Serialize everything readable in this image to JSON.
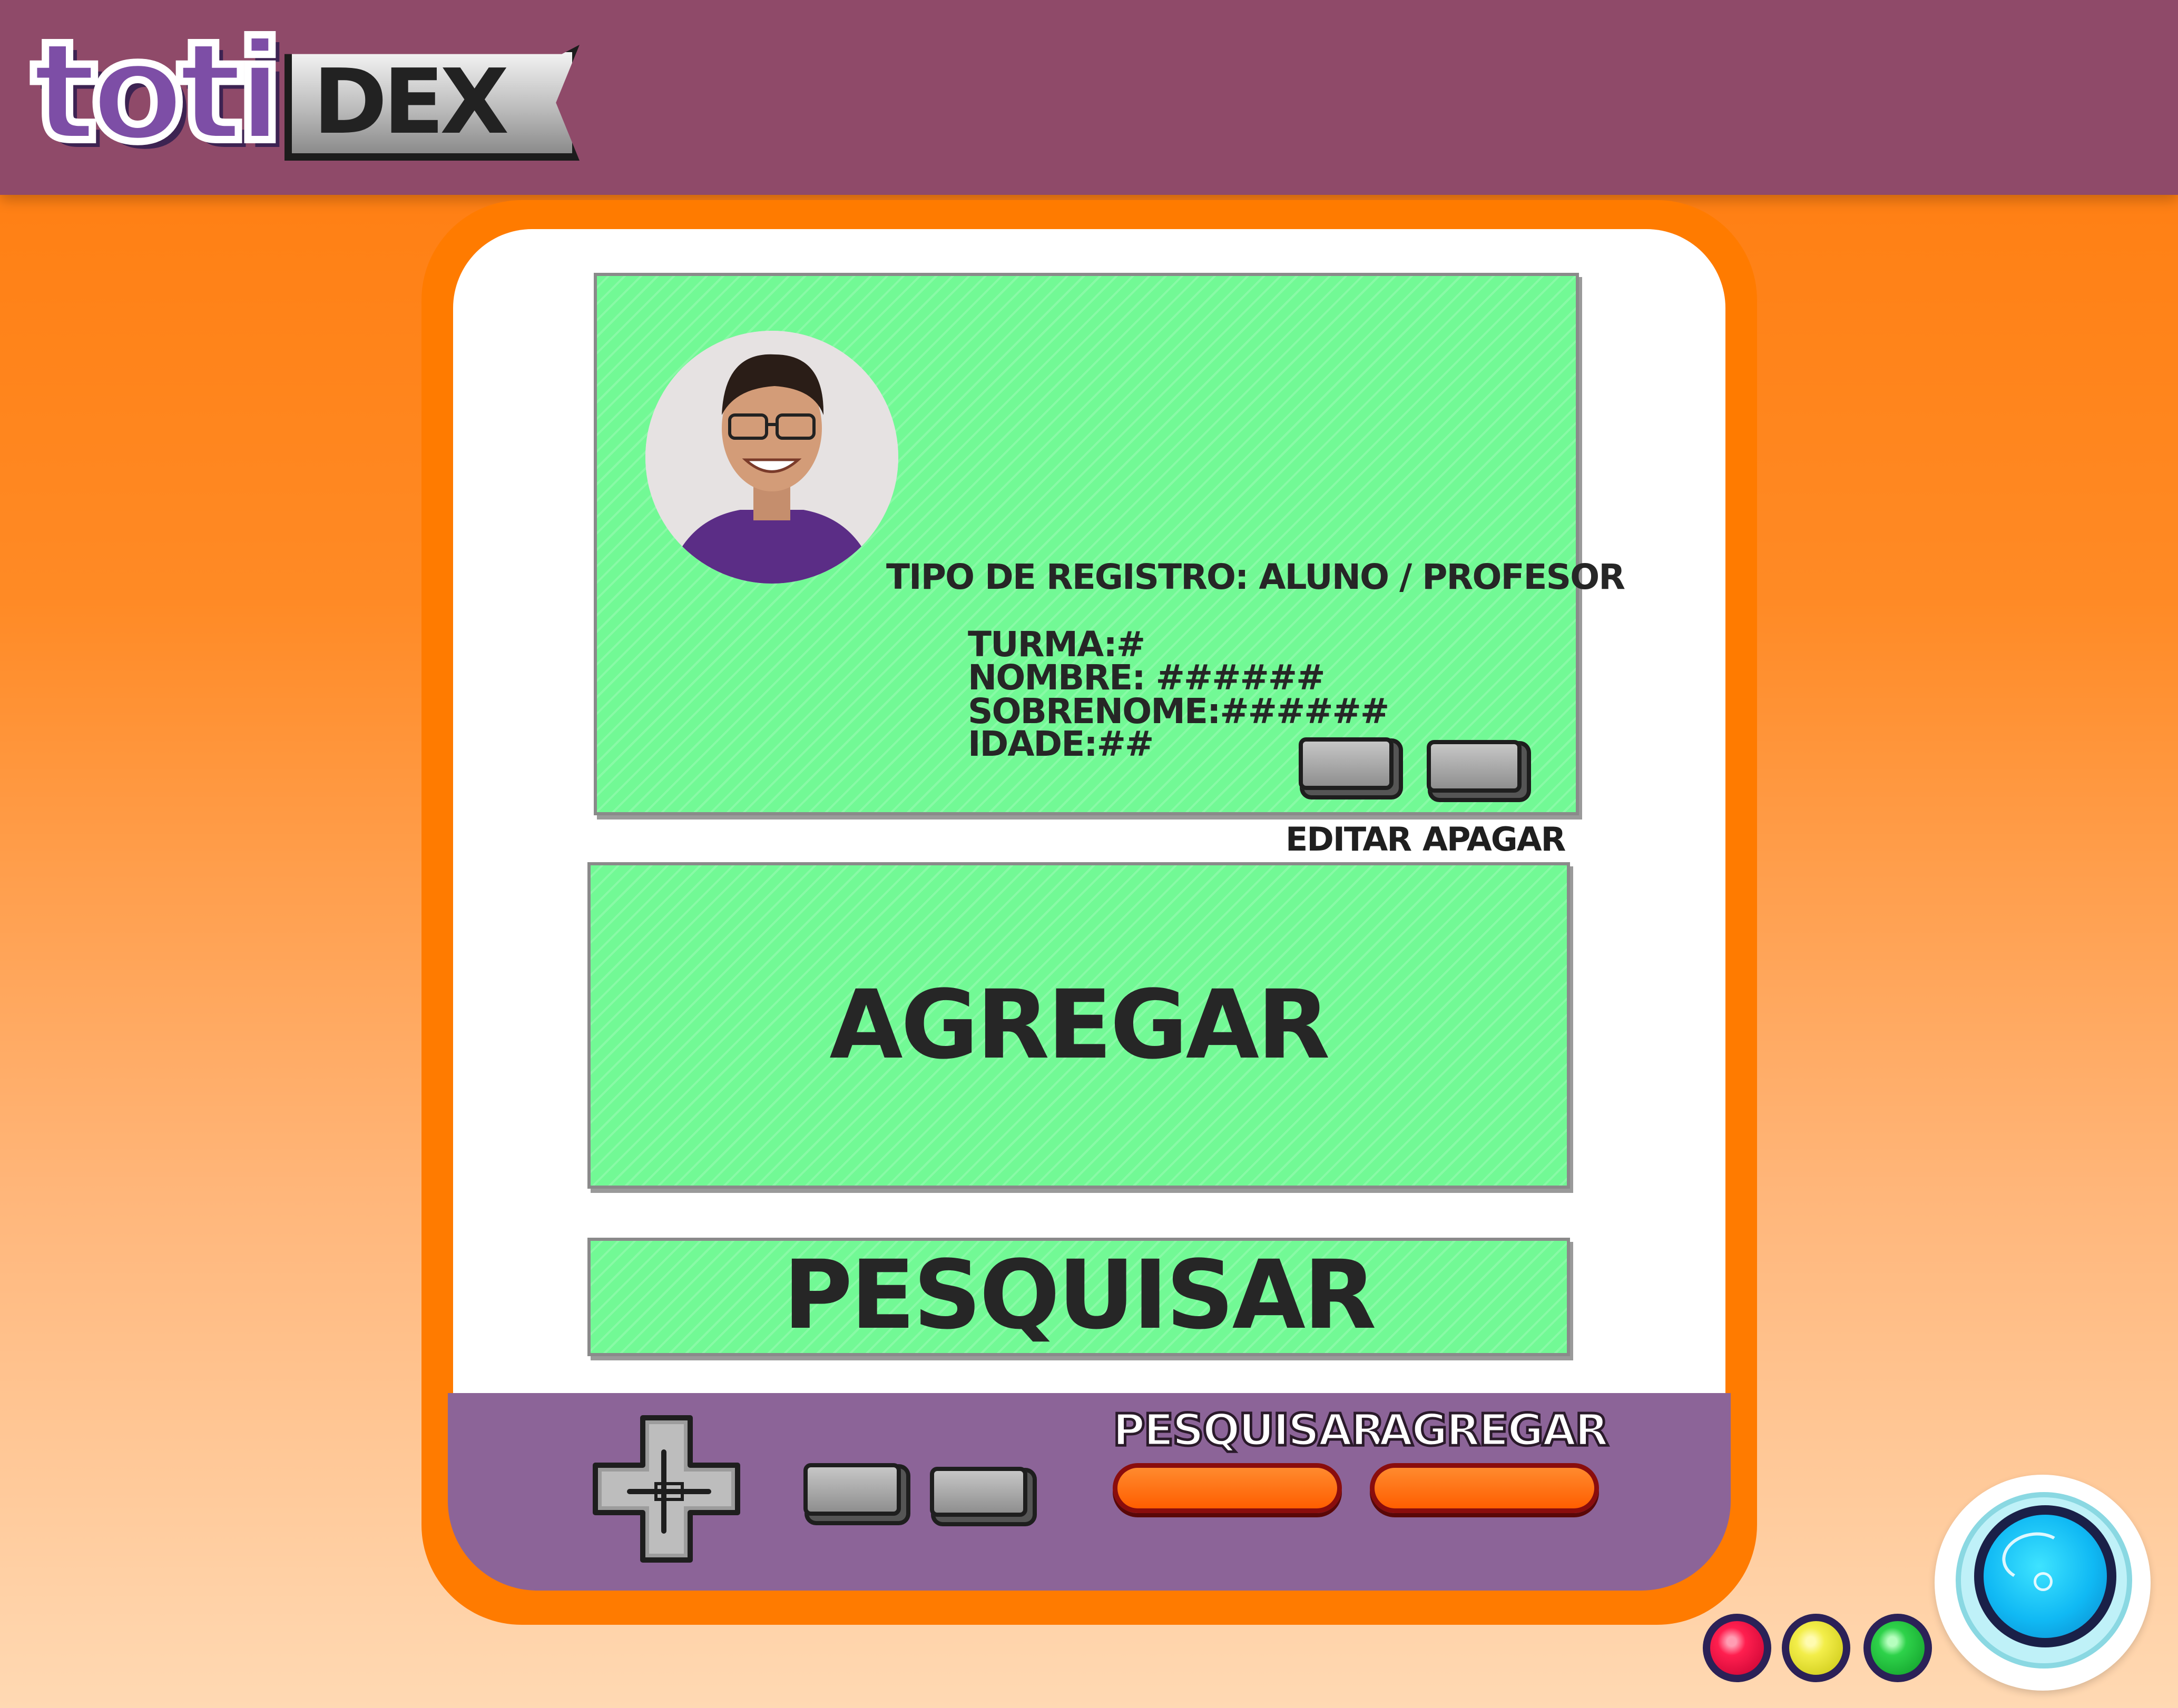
{
  "app": {
    "logo_text": "toti",
    "logo_dex": "DEX"
  },
  "record": {
    "photo_icon": "user-photo",
    "record_type": "TIPO DE REGISTRO: ALUNO / PROFESOR",
    "turma": "TURMA:#",
    "nombre": "NOMBRE: ######",
    "sobrenome": "SOBRENOME:######",
    "idade": "IDADE:##",
    "edit_label": "EDITAR",
    "delete_label": "APAGAR"
  },
  "actions": {
    "add_label": "AGREGAR",
    "search_label": "PESQUISAR"
  },
  "controls": {
    "dpad_icon": "dpad-icon",
    "shortcut_search_label": "PESQUISAR",
    "shortcut_add_label": "AGREGAR"
  },
  "colors": {
    "header": "#8f4a69",
    "device_frame": "#ff7b00",
    "screen_panel": "#72f995",
    "control_bar": "#8c6498",
    "accent_button": "#ff6a00"
  }
}
